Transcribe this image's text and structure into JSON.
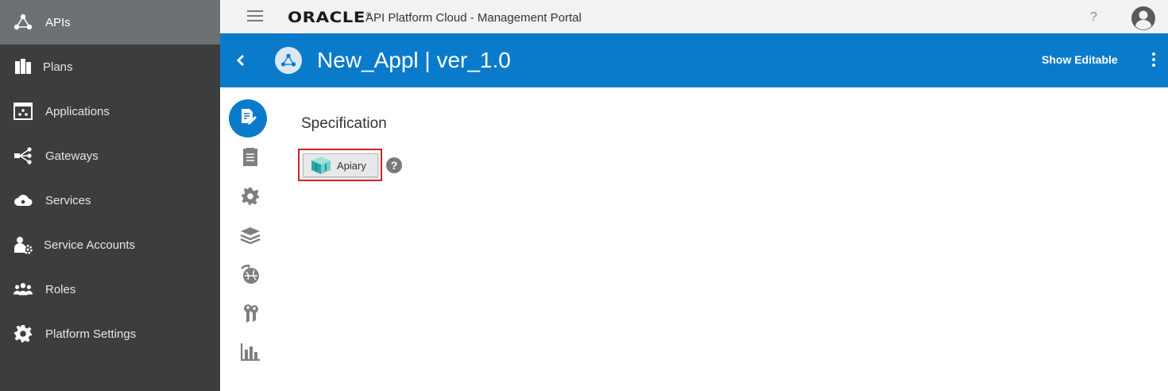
{
  "sidebar": {
    "items": [
      {
        "label": "APIs",
        "icon": "api-hub-icon",
        "active": true
      },
      {
        "label": "Plans",
        "icon": "plans-icon",
        "active": false
      },
      {
        "label": "Applications",
        "icon": "applications-icon",
        "active": false
      },
      {
        "label": "Gateways",
        "icon": "gateways-icon",
        "active": false
      },
      {
        "label": "Services",
        "icon": "services-icon",
        "active": false
      },
      {
        "label": "Service Accounts",
        "icon": "service-accounts-icon",
        "active": false
      },
      {
        "label": "Roles",
        "icon": "roles-icon",
        "active": false
      },
      {
        "label": "Platform Settings",
        "icon": "gear-icon",
        "active": false
      }
    ]
  },
  "header": {
    "brand": "ORACLE",
    "registered_mark": "®",
    "title": "API Platform Cloud - Management Portal",
    "help_label": "?"
  },
  "api_bar": {
    "title": "New_Appl | ver_1.0",
    "show_editable_label": "Show Editable"
  },
  "vertical_tabs": [
    {
      "icon": "specification-edit-icon",
      "active": true
    },
    {
      "icon": "document-list-icon",
      "active": false
    },
    {
      "icon": "settings-gear-icon",
      "active": false
    },
    {
      "icon": "layers-icon",
      "active": false
    },
    {
      "icon": "globe-publish-icon",
      "active": false
    },
    {
      "icon": "keys-icon",
      "active": false
    },
    {
      "icon": "analytics-chart-icon",
      "active": false
    }
  ],
  "content": {
    "section_title": "Specification",
    "apiary_button_label": "Apiary",
    "help_label": "?"
  },
  "colors": {
    "sidebar_bg": "#3b3d3f",
    "sidebar_active_bg": "#6e7174",
    "header_bg": "#f2f2f2",
    "accent_blue": "#0a7bca",
    "highlight_red": "#d0202a"
  }
}
